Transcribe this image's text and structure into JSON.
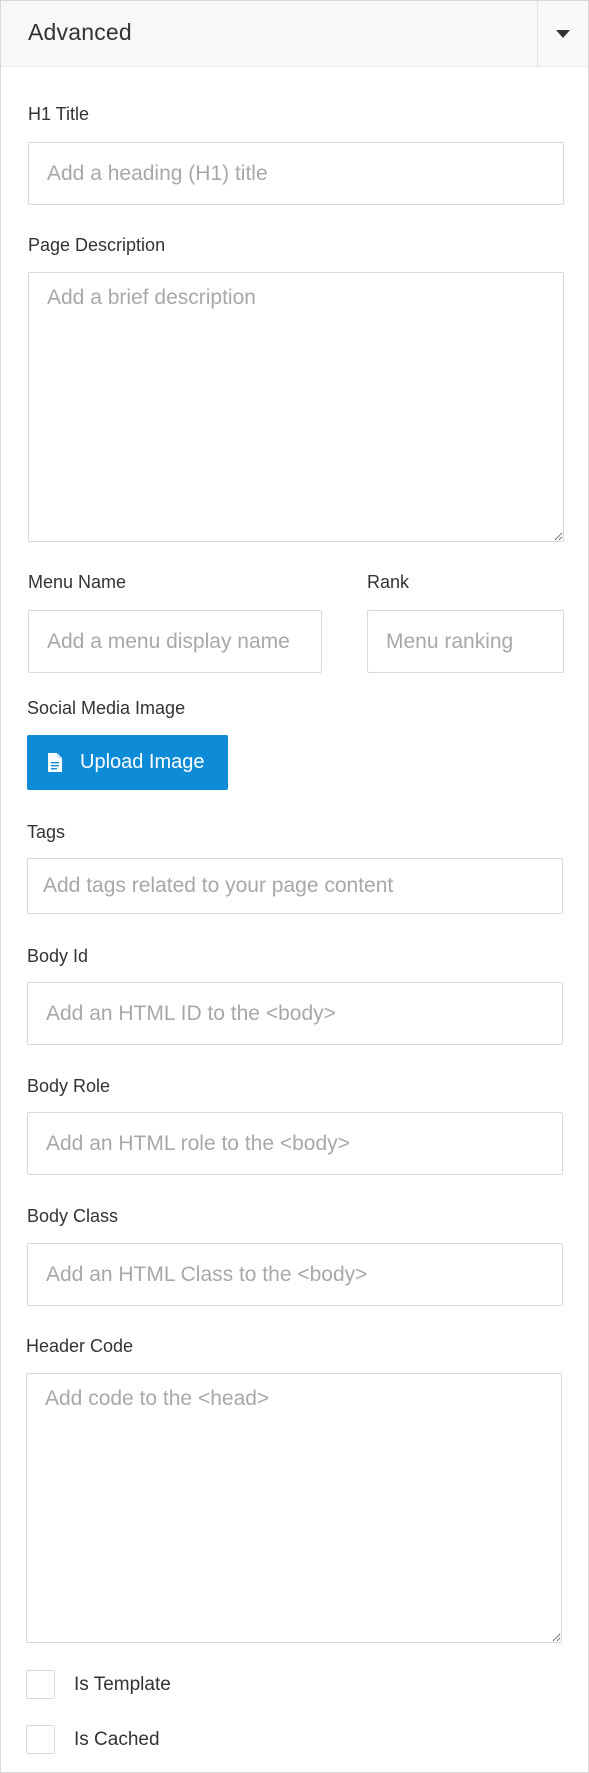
{
  "panel": {
    "title": "Advanced",
    "toggle_icon": "caret-down-icon"
  },
  "fields": {
    "h1_title": {
      "label": "H1 Title",
      "placeholder": "Add a heading (H1) title",
      "value": ""
    },
    "page_description": {
      "label": "Page Description",
      "placeholder": "Add a brief description",
      "value": ""
    },
    "menu_name": {
      "label": "Menu Name",
      "placeholder": "Add a menu display name",
      "value": ""
    },
    "rank": {
      "label": "Rank",
      "placeholder": "Menu ranking",
      "value": ""
    },
    "social_media_image": {
      "label": "Social Media Image",
      "button_label": "Upload Image",
      "button_icon": "file-icon"
    },
    "tags": {
      "label": "Tags",
      "placeholder": "Add tags related to your page content",
      "value": ""
    },
    "body_id": {
      "label": "Body Id",
      "placeholder": "Add an HTML ID to the <body>",
      "value": ""
    },
    "body_role": {
      "label": "Body Role",
      "placeholder": "Add an HTML role to the <body>",
      "value": ""
    },
    "body_class": {
      "label": "Body Class",
      "placeholder": "Add an HTML Class to the <body>",
      "value": ""
    },
    "header_code": {
      "label": "Header Code",
      "placeholder": "Add code to the <head>",
      "value": ""
    }
  },
  "checkboxes": {
    "is_template": {
      "label": "Is Template",
      "checked": false
    },
    "is_cached": {
      "label": "Is Cached",
      "checked": false
    }
  },
  "colors": {
    "accent": "#0d8bd6",
    "header_bg": "#f8f8f8",
    "border": "#d9d9d9",
    "placeholder": "#a8a8a8",
    "text": "#333333"
  }
}
